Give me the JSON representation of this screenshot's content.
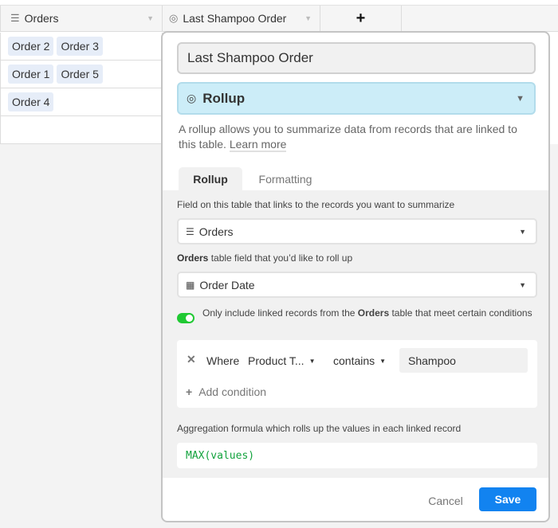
{
  "grid": {
    "columns": [
      {
        "label": "Orders",
        "icon": "linked-records-icon"
      },
      {
        "label": "Last Shampoo Order",
        "icon": "rollup-icon"
      }
    ],
    "add_column_label": "+",
    "rows": [
      {
        "orders": [
          "Order 2",
          "Order 3"
        ]
      },
      {
        "orders": [
          "Order 1",
          "Order 5"
        ]
      },
      {
        "orders": [
          "Order 4"
        ]
      }
    ]
  },
  "popup": {
    "field_name": "Last Shampoo Order",
    "field_type": "Rollup",
    "description": "A rollup allows you to summarize data from records that are linked to this table.",
    "learn_more": "Learn more",
    "tabs": [
      {
        "label": "Rollup",
        "active": true
      },
      {
        "label": "Formatting",
        "active": false
      }
    ],
    "link_field_label": "Field on this table that links to the records you want to summarize",
    "link_field_value": "Orders",
    "rollup_field_label_bold": "Orders",
    "rollup_field_label_rest": " table field that you’d like to roll up",
    "rollup_field_value": "Order Date",
    "filter_toggle_on": true,
    "filter_label_pre": "Only include linked records from the ",
    "filter_label_bold": "Orders",
    "filter_label_post": " table that meet certain conditions",
    "condition": {
      "where": "Where",
      "field": "Product T...",
      "operator": "contains",
      "value": "Shampoo"
    },
    "add_condition": "Add condition",
    "aggregation_label": "Aggregation formula which rolls up the values in each linked record",
    "formula": "MAX(values)",
    "cancel_label": "Cancel",
    "save_label": "Save"
  },
  "colors": {
    "accent": "#1283f0",
    "rollup_type_bg": "#ccedf8",
    "toggle_on": "#20c933",
    "formula_text": "#11a23c",
    "chip_bg": "#e6edf8"
  }
}
